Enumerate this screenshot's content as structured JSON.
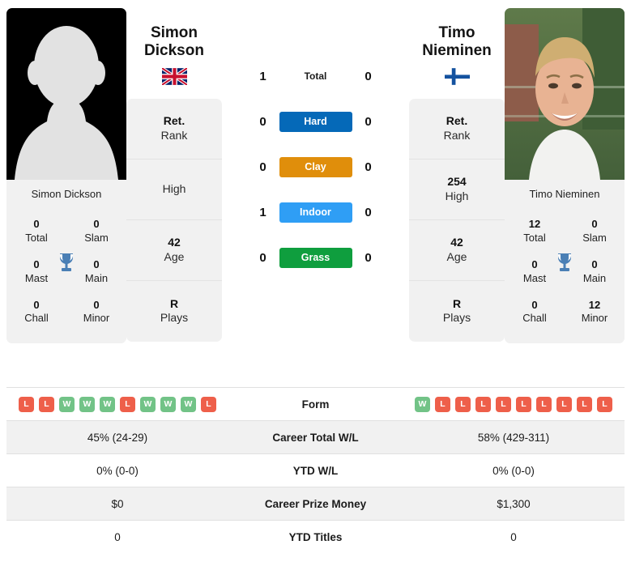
{
  "players": {
    "left": {
      "first_name": "Simon",
      "last_name": "Dickson",
      "full_name": "Simon Dickson",
      "photo_caption": "Simon Dickson",
      "flag": "gb-flag",
      "photo_type": "silhouette-placeholder",
      "bio": [
        {
          "value": "Ret.",
          "label": "Rank"
        },
        {
          "value": "",
          "label": "High"
        },
        {
          "value": "42",
          "label": "Age"
        },
        {
          "value": "R",
          "label": "Plays"
        }
      ],
      "titles": [
        {
          "value": "0",
          "label": "Total"
        },
        {
          "value": "0",
          "label": "Slam"
        },
        {
          "value": "0",
          "label": "Mast"
        },
        {
          "value": "0",
          "label": "Main"
        },
        {
          "value": "0",
          "label": "Chall"
        },
        {
          "value": "0",
          "label": "Minor"
        }
      ],
      "form": [
        "L",
        "L",
        "W",
        "W",
        "W",
        "L",
        "W",
        "W",
        "W",
        "L"
      ],
      "career_total_wl": "45% (24-29)",
      "ytd_wl": "0% (0-0)",
      "career_prize_money": "$0",
      "ytd_titles": "0"
    },
    "right": {
      "first_name": "Timo",
      "last_name": "Nieminen",
      "full_name": "Timo Nieminen",
      "photo_caption": "Timo Nieminen",
      "flag": "fi-flag",
      "photo_type": "player-photo",
      "bio": [
        {
          "value": "Ret.",
          "label": "Rank"
        },
        {
          "value": "254",
          "label": "High"
        },
        {
          "value": "42",
          "label": "Age"
        },
        {
          "value": "R",
          "label": "Plays"
        }
      ],
      "titles": [
        {
          "value": "12",
          "label": "Total"
        },
        {
          "value": "0",
          "label": "Slam"
        },
        {
          "value": "0",
          "label": "Mast"
        },
        {
          "value": "0",
          "label": "Main"
        },
        {
          "value": "0",
          "label": "Chall"
        },
        {
          "value": "12",
          "label": "Minor"
        }
      ],
      "form": [
        "W",
        "L",
        "L",
        "L",
        "L",
        "L",
        "L",
        "L",
        "L",
        "L"
      ],
      "career_total_wl": "58% (429-311)",
      "ytd_wl": "0% (0-0)",
      "career_prize_money": "$1,300",
      "ytd_titles": "0"
    }
  },
  "head_to_head": {
    "total": {
      "label": "Total",
      "left": "1",
      "right": "0"
    },
    "surfaces": [
      {
        "label": "Hard",
        "left": "0",
        "right": "0",
        "color": "#0569b8"
      },
      {
        "label": "Clay",
        "left": "0",
        "right": "0",
        "color": "#e08e0b"
      },
      {
        "label": "Indoor",
        "left": "1",
        "right": "0",
        "color": "#2f9ef5"
      },
      {
        "label": "Grass",
        "left": "0",
        "right": "0",
        "color": "#0f9e3e"
      }
    ]
  },
  "stats_rows": [
    {
      "label": "Form",
      "left": "",
      "right": ""
    },
    {
      "label": "Career Total W/L",
      "left": "45% (24-29)",
      "right": "58% (429-311)"
    },
    {
      "label": "YTD W/L",
      "left": "0% (0-0)",
      "right": "0% (0-0)"
    },
    {
      "label": "Career Prize Money",
      "left": "$0",
      "right": "$1,300"
    },
    {
      "label": "YTD Titles",
      "left": "0",
      "right": "0"
    }
  ],
  "colors": {
    "win_badge": "#72c387",
    "loss_badge": "#ee5f4a",
    "trophy": "#4a7fb5",
    "card_bg": "#f1f1f1"
  }
}
